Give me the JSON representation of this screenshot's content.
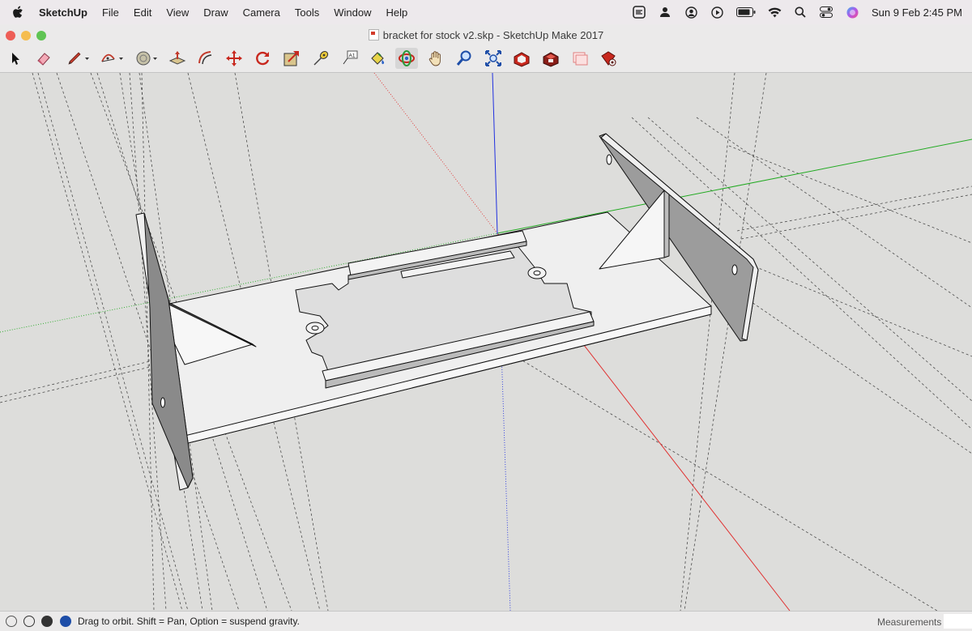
{
  "menubar": {
    "apple_icon": "apple-logo",
    "app_name": "SketchUp",
    "items": [
      "File",
      "Edit",
      "View",
      "Draw",
      "Camera",
      "Tools",
      "Window",
      "Help"
    ],
    "status_icons": [
      "sketchup-extension-icon",
      "user-icon",
      "account-circle-icon",
      "play-circle-icon",
      "battery-icon",
      "wifi-icon",
      "search-icon",
      "control-center-icon",
      "siri-icon"
    ],
    "clock": "Sun 9 Feb  2:45 PM"
  },
  "window": {
    "title": "bracket for stock v2.skp - SketchUp Make 2017"
  },
  "toolbar": {
    "tools": [
      "select",
      "eraser",
      "line",
      "arc",
      "shapes",
      "push-pull",
      "offset",
      "move",
      "rotate",
      "scale",
      "tape-measure",
      "text",
      "paint-bucket",
      "orbit",
      "pan",
      "zoom",
      "zoom-extents",
      "3d-warehouse",
      "extension-warehouse",
      "layout",
      "extension-manager"
    ],
    "active_tool": "orbit"
  },
  "statusbar": {
    "message": "Drag to orbit. Shift = Pan, Option = suspend gravity.",
    "measurements_label": "Measurements",
    "measurements_value": ""
  },
  "colors": {
    "axis_red": "#e03030",
    "axis_green": "#22aa22",
    "axis_blue": "#2030e0",
    "model_face": "#efefef",
    "model_back_face": "#9c9c9c"
  }
}
